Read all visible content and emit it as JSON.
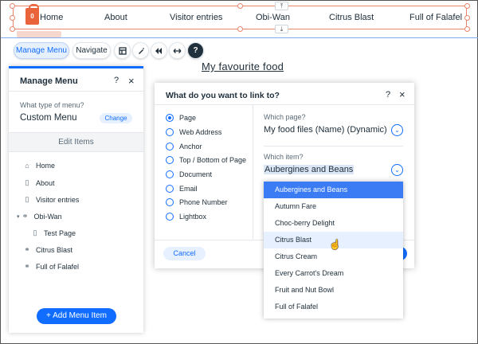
{
  "site_menu": {
    "cart_count": "0",
    "items": [
      "Home",
      "About",
      "Visitor entries",
      "Obi-Wan",
      "Citrus Blast",
      "Full of Falafel"
    ]
  },
  "toolbar": {
    "manage_menu": "Manage Menu",
    "navigate": "Navigate",
    "icons": [
      "layout-icon",
      "pen-icon",
      "animation-icon",
      "stretch-icon",
      "help-icon"
    ]
  },
  "heading": "My favourite food",
  "manage_panel": {
    "title": "Manage Menu",
    "help": "?",
    "close": "×",
    "menu_type_question": "What type of menu?",
    "menu_type": "Custom Menu",
    "change": "Change",
    "edit_items": "Edit Items",
    "items": [
      {
        "label": "Home",
        "icon": "home-icon"
      },
      {
        "label": "About",
        "icon": "page-icon"
      },
      {
        "label": "Visitor entries",
        "icon": "page-icon"
      },
      {
        "label": "Obi-Wan",
        "icon": "link-icon"
      },
      {
        "label": "Test Page",
        "icon": "page-icon"
      },
      {
        "label": "Citrus Blast",
        "icon": "link-icon"
      },
      {
        "label": "Full of Falafel",
        "icon": "link-icon"
      }
    ],
    "add_item": "+ Add Menu Item"
  },
  "link_dialog": {
    "title": "What do you want to link to?",
    "help": "?",
    "close": "×",
    "options": [
      "Page",
      "Web Address",
      "Anchor",
      "Top / Bottom of Page",
      "Document",
      "Email",
      "Phone Number",
      "Lightbox"
    ],
    "selected_option": "Page",
    "which_page_label": "Which page?",
    "which_page_value": "My food files (Name) (Dynamic)",
    "which_item_label": "Which item?",
    "which_item_value": "Aubergines and Beans",
    "cancel": "Cancel"
  },
  "item_dropdown": {
    "options": [
      "Aubergines and Beans",
      "Autumn Fare",
      "Choc-berry Delight",
      "Citrus Blast",
      "Citrus Cream",
      "Every Carrot's Dream",
      "Fruit and Nut Bowl",
      "Full of Falafel"
    ],
    "selected": "Aubergines and Beans",
    "hovered": "Citrus Blast"
  },
  "colors": {
    "accent": "#116dff",
    "selection_outline": "#e9856b",
    "cart": "#e9643a"
  }
}
